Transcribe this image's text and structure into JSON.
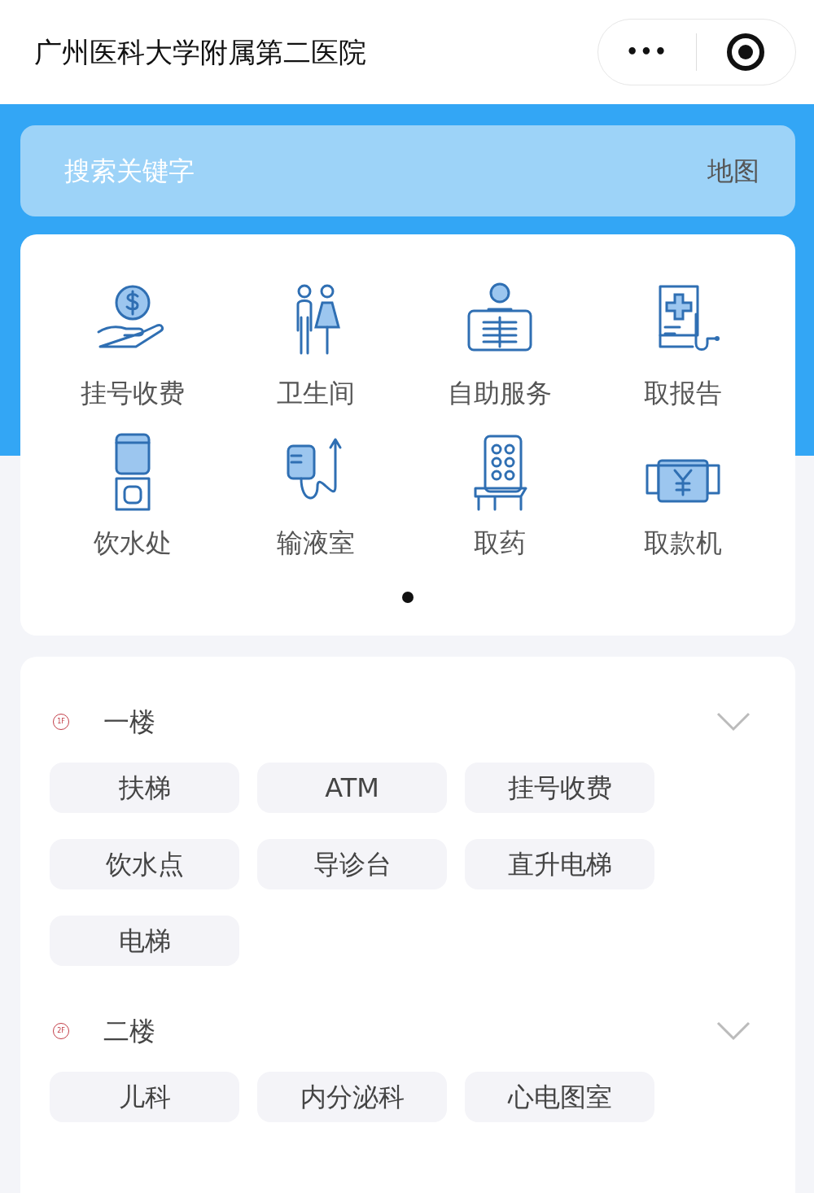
{
  "header": {
    "title": "广州医科大学附属第二医院",
    "more_button": "•••"
  },
  "search": {
    "placeholder": "搜索关键字",
    "map_link": "地图"
  },
  "services": [
    {
      "label": "挂号收费"
    },
    {
      "label": "卫生间"
    },
    {
      "label": "自助服务"
    },
    {
      "label": "取报告"
    },
    {
      "label": "饮水处"
    },
    {
      "label": "输液室"
    },
    {
      "label": "取药"
    },
    {
      "label": "取款机"
    }
  ],
  "pager": [
    {
      "selected": true
    }
  ],
  "floors": [
    {
      "badge": "1F",
      "name": "一楼",
      "expanded": true,
      "items": [
        "扶梯",
        "ATM",
        "挂号收费",
        "饮水点",
        "导诊台",
        "直升电梯",
        "电梯"
      ]
    },
    {
      "badge": "2F",
      "name": "二楼",
      "expanded": true,
      "items": [
        "儿科",
        "内分泌科",
        "心电图室"
      ]
    }
  ]
}
